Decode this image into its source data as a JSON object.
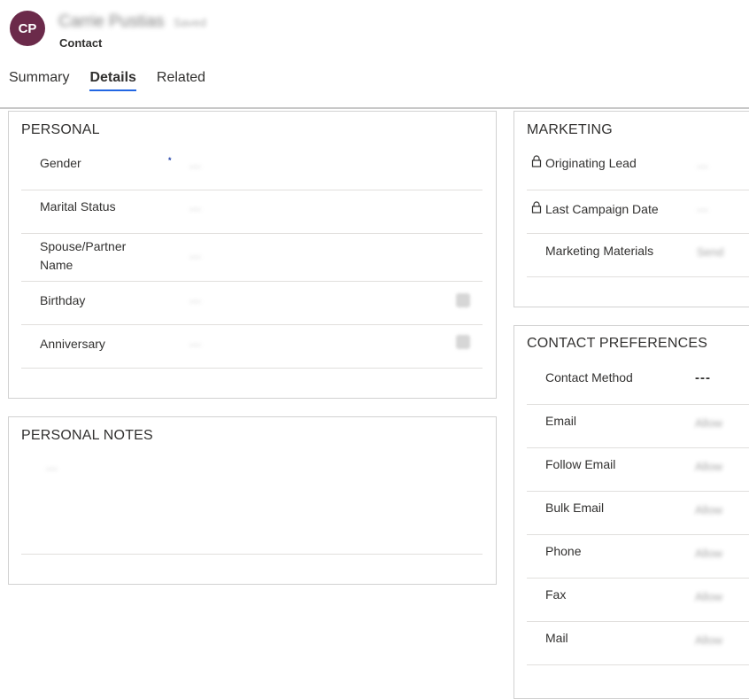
{
  "record": {
    "initials": "CP",
    "name": "Carrie Pustias",
    "subtitle": "Saved",
    "entity": "Contact"
  },
  "tabs": [
    {
      "label": "Summary",
      "active": false
    },
    {
      "label": "Details",
      "active": true
    },
    {
      "label": "Related",
      "active": false
    }
  ],
  "personal": {
    "title": "PERSONAL",
    "gender_label": "Gender",
    "gender_required": "*",
    "gender_value": "---",
    "marital_label": "Marital Status",
    "marital_value": "---",
    "spouse_label_1": "Spouse/Partner",
    "spouse_label_2": "Name",
    "spouse_value": "---",
    "birthday_label": "Birthday",
    "birthday_value": "---",
    "anniversary_label": "Anniversary",
    "anniversary_value": "---"
  },
  "notes": {
    "title": "PERSONAL NOTES",
    "value": "---"
  },
  "marketing": {
    "title": "MARKETING",
    "originating_label": "Originating Lead",
    "originating_value": "---",
    "campaign_label": "Last Campaign Date",
    "campaign_value": "---",
    "materials_label": "Marketing Materials",
    "materials_value": "Send"
  },
  "contact_prefs": {
    "title": "CONTACT PREFERENCES",
    "method_label": "Contact Method",
    "method_value": "---",
    "email_label": "Email",
    "email_value": "Allow",
    "follow_label": "Follow Email",
    "follow_value": "Allow",
    "bulk_label": "Bulk Email",
    "bulk_value": "Allow",
    "phone_label": "Phone",
    "phone_value": "Allow",
    "fax_label": "Fax",
    "fax_value": "Allow",
    "mail_label": "Mail",
    "mail_value": "Allow"
  }
}
